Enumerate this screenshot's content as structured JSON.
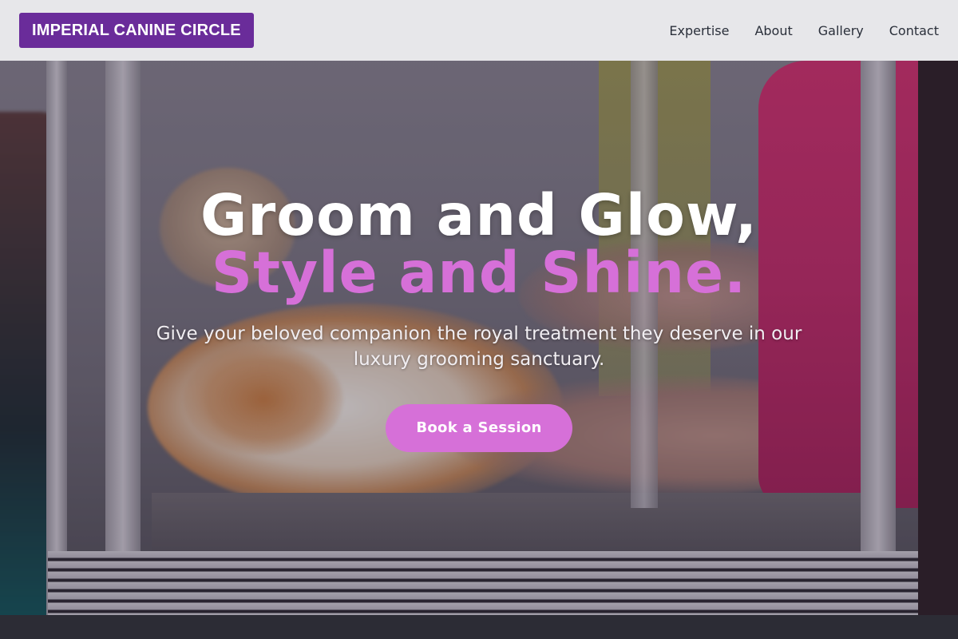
{
  "brand": {
    "name": "IMPERIAL CANINE CIRCLE",
    "color": "#6a2c9a"
  },
  "nav": {
    "items": [
      {
        "label": "Expertise"
      },
      {
        "label": "About"
      },
      {
        "label": "Gallery"
      },
      {
        "label": "Contact"
      }
    ]
  },
  "hero": {
    "headline_line1": "Groom and Glow,",
    "headline_line2": "Style and Shine.",
    "accent_color": "#d670d8",
    "subtitle": "Give your beloved companion the royal treatment they deserve in our luxury grooming sanctuary.",
    "cta_label": "Book a Session",
    "background_image": "grooming photo: long-haired cat being groomed in a metal-framed enclosure, groomer in pink shirt"
  }
}
